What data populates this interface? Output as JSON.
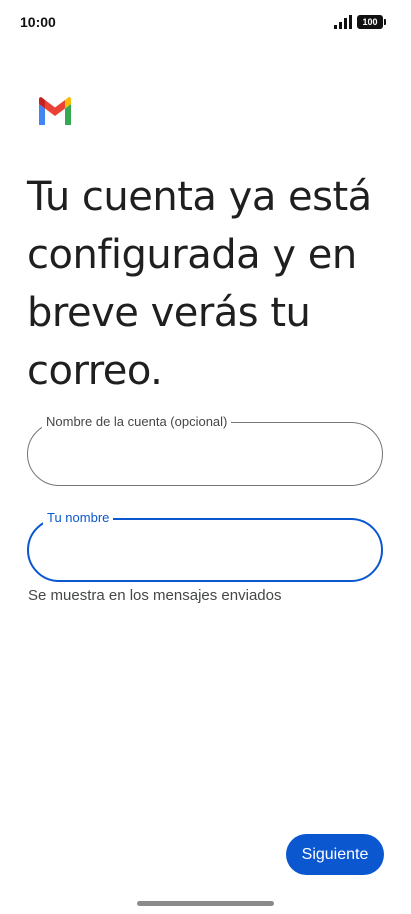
{
  "status_bar": {
    "time": "10:00",
    "battery": "100",
    "icons": [
      "signal-icon",
      "battery-icon"
    ]
  },
  "logo": {
    "icon": "gmail-logo-icon",
    "colors": [
      "#4285F4",
      "#EA4335",
      "#FBBC04",
      "#34A853",
      "#C5221F"
    ]
  },
  "headline": "Tu cuenta ya está configurada y en breve verás tu correo.",
  "form": {
    "account_name": {
      "label": "Nombre de la cuenta (opcional)",
      "value": ""
    },
    "your_name": {
      "label": "Tu nombre",
      "value": "",
      "helper": "Se muestra en los mensajes enviados",
      "focused": true
    }
  },
  "actions": {
    "next_label": "Siguiente"
  },
  "colors": {
    "accent": "#0b57d0",
    "outline": "#747775",
    "text": "#1f1f1f"
  }
}
